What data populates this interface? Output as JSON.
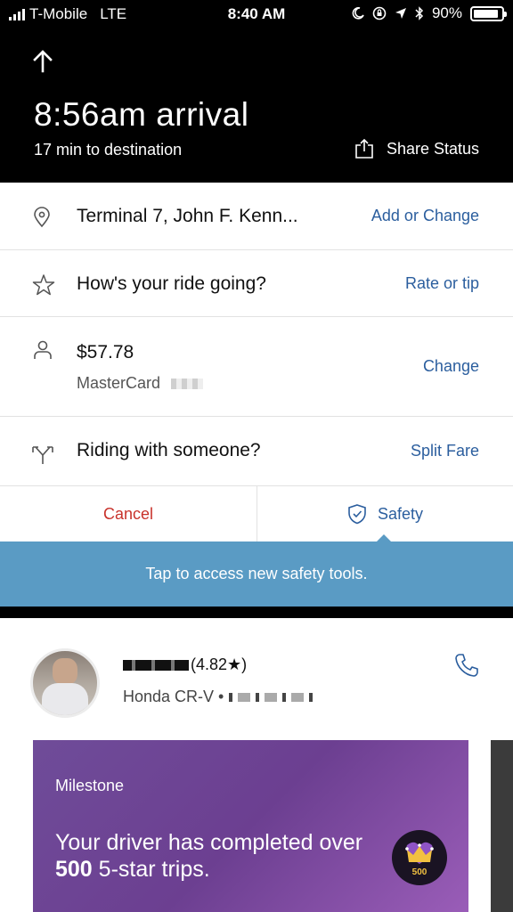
{
  "status_bar": {
    "carrier": "T-Mobile",
    "network": "LTE",
    "time": "8:40 AM",
    "battery": "90%",
    "battery_level": 0.9
  },
  "trip": {
    "arrival": "8:56am arrival",
    "eta": "17 min to destination",
    "share_label": "Share Status"
  },
  "rows": {
    "destination": {
      "label": "Terminal 7, John F. Kenn...",
      "action": "Add or Change"
    },
    "rating": {
      "label": "How's your ride going?",
      "action": "Rate or tip"
    },
    "payment": {
      "amount": "$57.78",
      "card": "MasterCard",
      "action": "Change"
    },
    "split": {
      "label": "Riding with someone?",
      "action": "Split Fare"
    }
  },
  "actions": {
    "cancel": "Cancel",
    "safety": "Safety"
  },
  "tooltip": "Tap to access new safety tools.",
  "driver": {
    "rating": "(4.82★)",
    "car": "Honda CR-V •"
  },
  "milestone": {
    "label": "Milestone",
    "text_before": "Your driver has completed over ",
    "count": "500",
    "text_after": " 5-star trips.",
    "badge": "500"
  },
  "colors": {
    "link": "#2b5e9e",
    "cancel": "#c8322b",
    "tooltip": "#5a9bc4",
    "card": "#6c3f91"
  }
}
